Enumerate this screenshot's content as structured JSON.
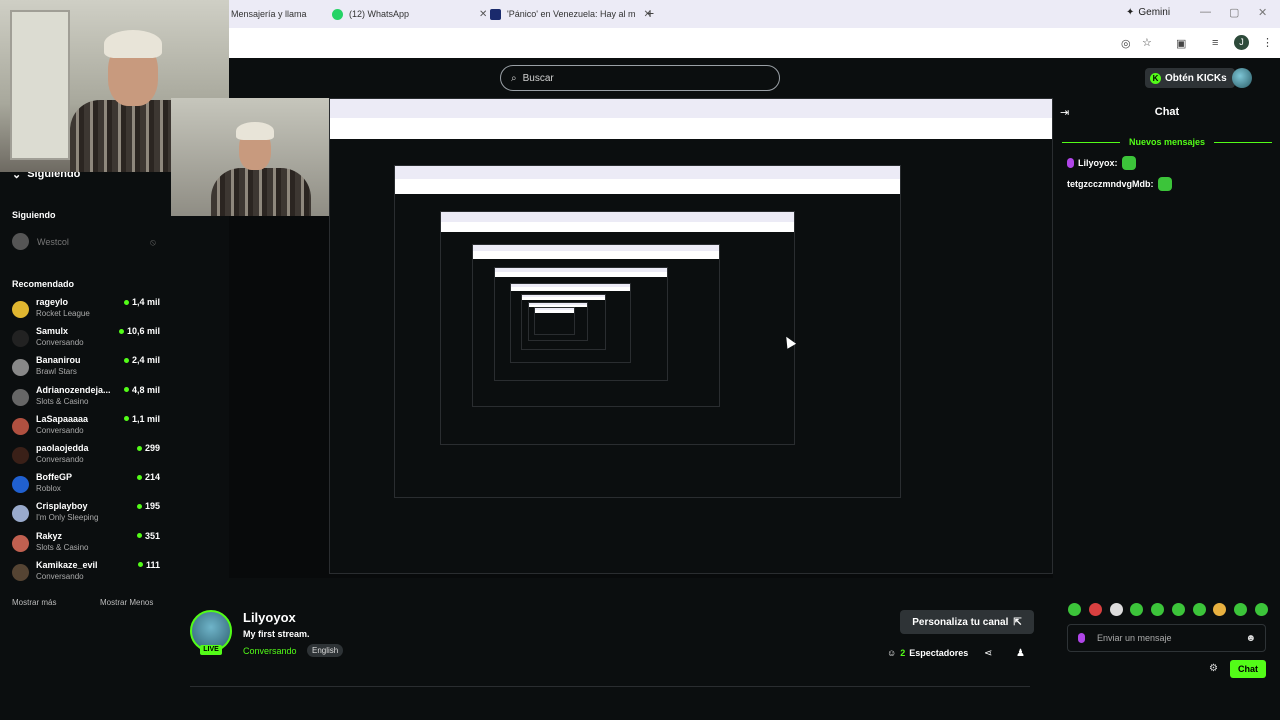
{
  "browser": {
    "tabs": [
      {
        "label": "Mensajería y llama",
        "favicon_color": "#ffffff"
      },
      {
        "label": "(12) WhatsApp",
        "favicon_color": "#25d366"
      },
      {
        "label": "'Pánico' en Venezuela: Hay al m",
        "favicon_color": "#1a2a6c"
      }
    ],
    "gemini_label": "Gemini",
    "profile_initial": "J"
  },
  "header": {
    "search_placeholder": "Buscar",
    "kicks_label": "Obtén KICKs"
  },
  "sidebar": {
    "collapse_label": "Siguiendo",
    "following_title": "Siguiendo",
    "following": [
      {
        "name": "Westcol"
      }
    ],
    "recommended_title": "Recomendado",
    "recommended": [
      {
        "name": "rageylo",
        "category": "Rocket League",
        "viewers": "1,4 mil",
        "color": "#e0b630"
      },
      {
        "name": "Samulx",
        "category": "Conversando",
        "viewers": "10,6 mil",
        "color": "#222222"
      },
      {
        "name": "Bananirou",
        "category": "Brawl Stars",
        "viewers": "2,4 mil",
        "color": "#888888"
      },
      {
        "name": "Adrianozendeja...",
        "category": "Slots & Casino",
        "viewers": "4,8 mil",
        "color": "#666666"
      },
      {
        "name": "LaSapaaaaa",
        "category": "Conversando",
        "viewers": "1,1 mil",
        "color": "#b05040"
      },
      {
        "name": "paolaojedda",
        "category": "Conversando",
        "viewers": "299",
        "color": "#3a2018"
      },
      {
        "name": "BoffeGP",
        "category": "Roblox",
        "viewers": "214",
        "color": "#2060d0"
      },
      {
        "name": "Crisplayboy",
        "category": "I'm Only Sleeping",
        "viewers": "195",
        "color": "#9ac"
      },
      {
        "name": "Rakyz",
        "category": "Slots & Casino",
        "viewers": "351",
        "color": "#c06050"
      },
      {
        "name": "Kamikaze_evil",
        "category": "Conversando",
        "viewers": "111",
        "color": "#554433"
      }
    ],
    "show_more": "Mostrar más",
    "show_less": "Mostrar Menos"
  },
  "stream": {
    "streamer": "Lilyoyox",
    "title": "My first stream.",
    "category": "Conversando",
    "language": "English",
    "live": "LIVE",
    "customize_label": "Personaliza tu canal",
    "viewers_count": "2",
    "viewers_label": "Espectadores"
  },
  "chat": {
    "title": "Chat",
    "new_messages": "Nuevos mensajes",
    "messages": [
      {
        "user": "Lilyoyox:",
        "color": "#ffffff"
      },
      {
        "user": "tetgzcczmndvgMdb:",
        "color": "#ffffff"
      }
    ],
    "input_placeholder": "Enviar un mensaje",
    "send_label": "Chat"
  },
  "colors": {
    "accent": "#53fc18",
    "background": "#0b0e0f",
    "surface": "#2e3336"
  }
}
